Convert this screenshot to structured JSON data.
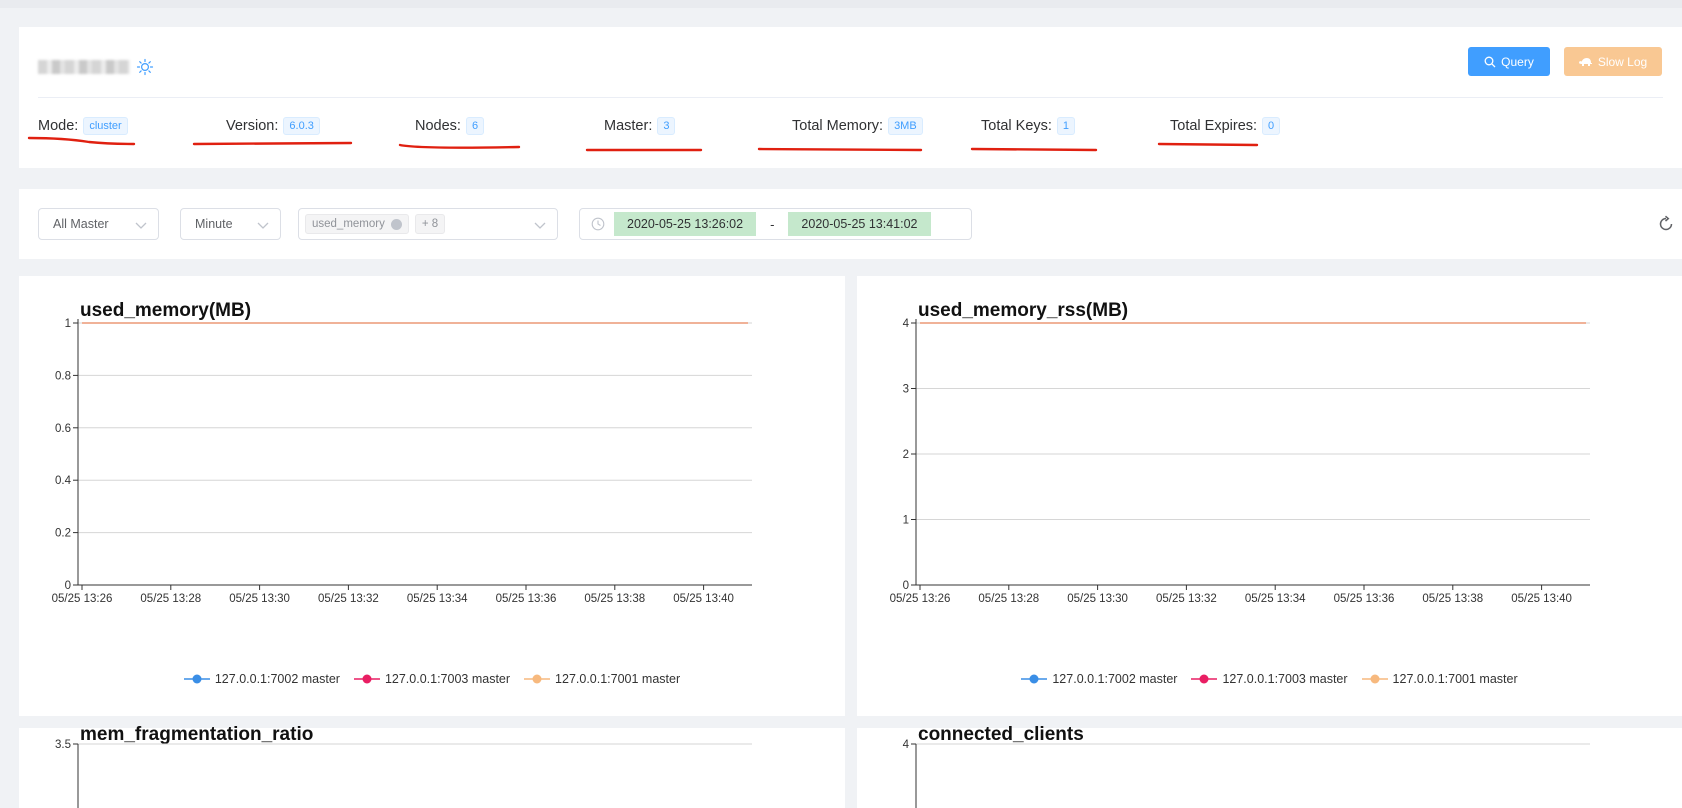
{
  "header": {
    "query_label": "Query",
    "slowlog_label": "Slow Log",
    "stats": [
      {
        "label": "Mode:",
        "value": "cluster"
      },
      {
        "label": "Version:",
        "value": "6.0.3"
      },
      {
        "label": "Nodes:",
        "value": "6"
      },
      {
        "label": "Master:",
        "value": "3"
      },
      {
        "label": "Total Memory:",
        "value": "3MB"
      },
      {
        "label": "Total Keys:",
        "value": "1"
      },
      {
        "label": "Total Expires:",
        "value": "0"
      }
    ]
  },
  "filters": {
    "node_select": "All Master",
    "interval_select": "Minute",
    "metric_chip": "used_memory",
    "metric_more": "+ 8",
    "start_time": "2020-05-25 13:26:02",
    "range_separator": "-",
    "end_time": "2020-05-25 13:41:02"
  },
  "colors": {
    "accent": "#409eff",
    "slow_log": "#f9c893",
    "annotation_underline": "#e02010",
    "series_7002": "#3a8ee6",
    "series_7003": "#e91e63",
    "series_7001": "#f7b97e"
  },
  "icons": {
    "cluster": "sun-icon",
    "query": "search-icon",
    "slowlog": "turtle-icon",
    "date": "clock-icon",
    "refresh": "refresh-icon",
    "select": "chevron-down-icon"
  },
  "chart_data": [
    {
      "type": "line",
      "title": "used_memory(MB)",
      "categories": [
        "05/25 13:26",
        "05/25 13:28",
        "05/25 13:30",
        "05/25 13:32",
        "05/25 13:34",
        "05/25 13:36",
        "05/25 13:38",
        "05/25 13:40"
      ],
      "ylim": [
        0,
        1
      ],
      "yticks": [
        "0",
        "0.2",
        "0.4",
        "0.6",
        "0.8",
        "1"
      ],
      "x_range": [
        "13:26",
        "13:41"
      ],
      "series": [
        {
          "name": "127.0.0.1:7002 master",
          "x": [
            "13:26",
            "13:41"
          ],
          "values": [
            1,
            1
          ]
        },
        {
          "name": "127.0.0.1:7003 master",
          "x": [
            "13:26",
            "13:41"
          ],
          "values": [
            1,
            1
          ]
        },
        {
          "name": "127.0.0.1:7001 master",
          "x": [
            "13:26",
            "13:41"
          ],
          "values": [
            1,
            1
          ]
        }
      ],
      "grid": true,
      "legend": "bottom-center"
    },
    {
      "type": "line",
      "title": "used_memory_rss(MB)",
      "categories": [
        "05/25 13:26",
        "05/25 13:28",
        "05/25 13:30",
        "05/25 13:32",
        "05/25 13:34",
        "05/25 13:36",
        "05/25 13:38",
        "05/25 13:40"
      ],
      "ylim": [
        0,
        4
      ],
      "yticks": [
        "0",
        "1",
        "2",
        "3",
        "4"
      ],
      "x_range": [
        "13:26",
        "13:41"
      ],
      "series": [
        {
          "name": "127.0.0.1:7002 master",
          "x": [
            "13:26",
            "13:41"
          ],
          "values": [
            4,
            4
          ]
        },
        {
          "name": "127.0.0.1:7003 master",
          "x": [
            "13:26",
            "13:41"
          ],
          "values": [
            4,
            4
          ]
        },
        {
          "name": "127.0.0.1:7001 master",
          "x": [
            "13:26",
            "13:41"
          ],
          "values": [
            4,
            4
          ]
        }
      ],
      "grid": true,
      "legend": "bottom-center"
    },
    {
      "type": "line",
      "title": "mem_fragmentation_ratio",
      "yticks": [
        "3.5"
      ]
    },
    {
      "type": "line",
      "title": "connected_clients",
      "yticks": [
        "4"
      ]
    }
  ]
}
